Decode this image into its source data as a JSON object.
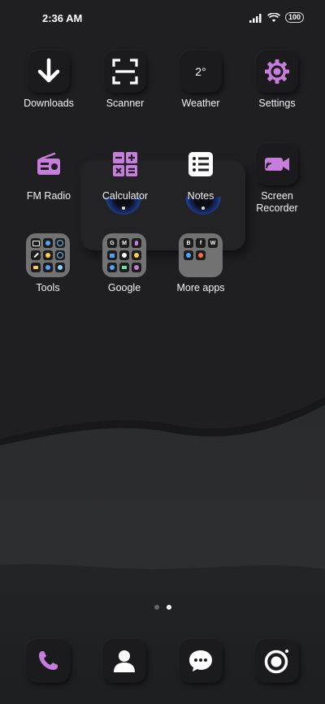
{
  "status": {
    "time": "2:36 AM",
    "battery": "100"
  },
  "apps": {
    "downloads": "Downloads",
    "scanner": "Scanner",
    "weather": "Weather",
    "weather_temp": "2°",
    "settings": "Settings",
    "fm_radio": "FM Radio",
    "calculator": "Calculator",
    "notes": "Notes",
    "screen_recorder": "Screen\nRecorder",
    "tools": "Tools",
    "google": "Google",
    "more_apps": "More apps"
  },
  "folders": {
    "google_mini": [
      "G",
      "M",
      "",
      "",
      "",
      "",
      "",
      "",
      ""
    ],
    "more_apps_mini": [
      "B",
      "f",
      "W",
      "",
      ""
    ]
  },
  "dock": [
    "phone-icon",
    "contacts-icon",
    "messages-icon",
    "camera-icon"
  ],
  "colors": {
    "accent": "#c77ddb",
    "background": "#1f1f21"
  }
}
